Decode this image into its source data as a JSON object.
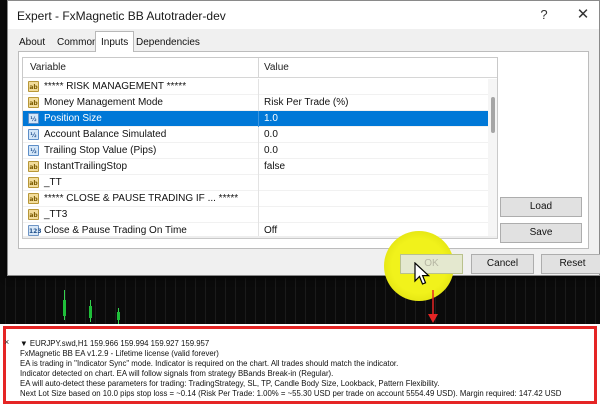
{
  "dialog": {
    "title": "Expert - FxMagnetic BB Autotrader-dev",
    "help_button": "?",
    "close_button": "✕",
    "tabs": [
      {
        "label": "About"
      },
      {
        "label": "Common"
      },
      {
        "label": "Inputs"
      },
      {
        "label": "Dependencies"
      }
    ],
    "grid": {
      "headers": {
        "variable": "Variable",
        "value": "Value"
      },
      "rows": [
        {
          "icon": "ab",
          "variable": "***** RISK MANAGEMENT *****",
          "value": ""
        },
        {
          "icon": "ab",
          "variable": "Money Management Mode",
          "value": "Risk Per Trade (%)"
        },
        {
          "icon": "vz",
          "variable": "Position Size",
          "value": "1.0",
          "selected": true
        },
        {
          "icon": "vz",
          "variable": "Account Balance Simulated",
          "value": "0.0"
        },
        {
          "icon": "vz",
          "variable": "Trailing Stop Value (Pips)",
          "value": "0.0"
        },
        {
          "icon": "ab",
          "variable": "InstantTrailingStop",
          "value": "false"
        },
        {
          "icon": "ab",
          "variable": "_TT",
          "value": ""
        },
        {
          "icon": "ab",
          "variable": "***** CLOSE & PAUSE TRADING IF ... *****",
          "value": ""
        },
        {
          "icon": "ab",
          "variable": "_TT3",
          "value": ""
        },
        {
          "icon": "num",
          "variable": "Close & Pause Trading On Time",
          "value": "Off"
        }
      ]
    },
    "buttons": {
      "load": "Load",
      "save": "Save",
      "ok": "OK",
      "cancel": "Cancel",
      "reset": "Reset"
    }
  },
  "log": {
    "close_glyph": "×",
    "lines": [
      "▼ EURJPY.swd,H1  159.966 159.994 159.927 159.957",
      "FxMagnetic BB EA  v1.2.9 - Lifetime license (valid forever)",
      "EA is trading in \"Indicator Sync\" mode. Indicator is required on the chart. All trades should match the indicator.",
      "Indicator detected on chart. EA will follow signals from strategy BBands Break-in (Regular).",
      "EA will auto-detect these parameters for trading: TradingStrategy, SL, TP, Candle Body Size, Lookback, Pattern Flexibility.",
      "Next Lot Size based on 10.0 pips stop loss = ~0.14 (Risk Per Trade: 1.00% = ~55.30 USD per trade on account 5554.49 USD). Margin required: 147.42 USD"
    ]
  },
  "colors": {
    "selection": "#0078d7",
    "highlight_border": "#e52525",
    "cursor_highlight": "#f1f21b"
  }
}
